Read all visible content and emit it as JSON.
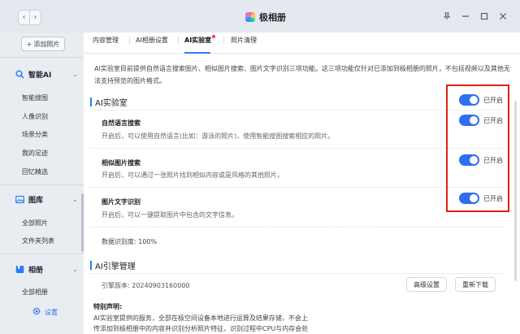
{
  "window": {
    "title": "极相册",
    "nav_back": "‹",
    "nav_forward": "›"
  },
  "sidebar": {
    "add_photo": "添加照片",
    "groups": [
      {
        "label": "智能AI",
        "items": [
          "智能搜图",
          "人像识别",
          "场景分类",
          "我的足迹",
          "回忆精选"
        ]
      },
      {
        "label": "图库",
        "items": [
          "全部照片",
          "文件夹列表"
        ]
      },
      {
        "label": "相册",
        "items": [
          "全部相册"
        ]
      }
    ],
    "settings": "设置"
  },
  "tabs": [
    "内容管理",
    "AI相册设置",
    "AI实验室",
    "照片清理"
  ],
  "intro": "AI实验室目前提供自然语言搜索图片、相似图片搜索、图片文字识别三项功能。这三项功能仅针对已添加到极相册的照片，不包括视频以及其他无法支持预览的图片格式。",
  "lab": {
    "heading": "AI实验室",
    "master_toggle_label": "已开启",
    "features": [
      {
        "title": "自然语言搜索",
        "desc": "开启后，可以使用自然语言(比如：游泳的照片)，使用智能搜图搜索相应的照片。",
        "toggle_label": "已开启"
      },
      {
        "title": "相似图片搜索",
        "desc": "开启后，可以通过一张照片找到相似内容或是风格的其他照片。",
        "toggle_label": "已开启"
      },
      {
        "title": "图片文字识别",
        "desc": "开启后，可以一键提取图片中包含的文字信息。",
        "toggle_label": "已开启"
      }
    ],
    "accuracy": "数据识别度: 100%"
  },
  "engine": {
    "heading": "AI引擎管理",
    "version": "引擎版本: 20240903160000",
    "advanced_button": "高级设置",
    "redownload_button": "重新下载"
  },
  "disclaimer": {
    "title": "特别声明:",
    "text": "AI实验室提供的服务，全部在极空间设备本地进行运算及结果存储，不会上传添加到极相册中的内容并识别分析照片特征，识别过程中CPU与内存会处于"
  },
  "colors": {
    "accent": "#2d6ff0",
    "highlight_box": "#e0201a",
    "tab_badge": "#ff3b30"
  }
}
